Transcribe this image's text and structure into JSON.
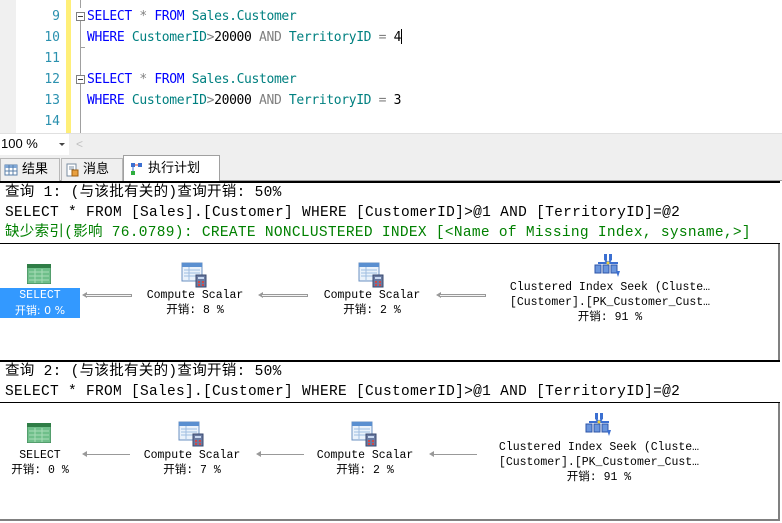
{
  "editor": {
    "lines": [
      {
        "num": "9",
        "tokens": [
          {
            "t": "SELECT",
            "c": "kw"
          },
          {
            "t": " * ",
            "c": "op"
          },
          {
            "t": "FROM",
            "c": "kw"
          },
          {
            "t": " Sales.Customer",
            "c": "id"
          }
        ]
      },
      {
        "num": "10",
        "tokens": [
          {
            "t": "WHERE",
            "c": "kw"
          },
          {
            "t": " CustomerID",
            "c": "id"
          },
          {
            "t": ">",
            "c": "op"
          },
          {
            "t": "20000",
            "c": "num"
          },
          {
            "t": " AND",
            "c": "op"
          },
          {
            "t": " TerritoryID",
            "c": "id"
          },
          {
            "t": " = ",
            "c": "op"
          },
          {
            "t": "4",
            "c": "num"
          }
        ]
      },
      {
        "num": "11",
        "tokens": []
      },
      {
        "num": "12",
        "tokens": [
          {
            "t": "SELECT",
            "c": "kw"
          },
          {
            "t": " * ",
            "c": "op"
          },
          {
            "t": "FROM",
            "c": "kw"
          },
          {
            "t": " Sales.Customer",
            "c": "id"
          }
        ]
      },
      {
        "num": "13",
        "tokens": [
          {
            "t": "WHERE",
            "c": "kw"
          },
          {
            "t": " CustomerID",
            "c": "id"
          },
          {
            "t": ">",
            "c": "op"
          },
          {
            "t": "20000",
            "c": "num"
          },
          {
            "t": " AND",
            "c": "op"
          },
          {
            "t": " TerritoryID",
            "c": "id"
          },
          {
            "t": " = ",
            "c": "op"
          },
          {
            "t": "3",
            "c": "num"
          }
        ]
      },
      {
        "num": "14",
        "tokens": []
      }
    ]
  },
  "zoom": {
    "value": "100 %"
  },
  "tabs": [
    {
      "label": "结果",
      "icon": "grid-icon",
      "active": false
    },
    {
      "label": "消息",
      "icon": "message-icon",
      "active": false
    },
    {
      "label": "执行计划",
      "icon": "execution-plan-icon",
      "active": true
    }
  ],
  "queries": [
    {
      "header": "查询 1: (与该批有关的)查询开销: 50%",
      "sql": "SELECT * FROM [Sales].[Customer] WHERE [CustomerID]>@1 AND [TerritoryID]=@2",
      "missing_index": "缺少索引(影响 76.0789): CREATE NONCLUSTERED INDEX [<Name of Missing Index, sysname,>]",
      "nodes": [
        {
          "name": "SELECT",
          "cost": "开销: 0 %",
          "selected": true
        },
        {
          "name": "Compute Scalar",
          "cost": "开销: 8 %"
        },
        {
          "name": "Compute Scalar",
          "cost": "开销: 2 %"
        },
        {
          "name": "Clustered Index Seek (Cluste…",
          "sub": "[Customer].[PK_Customer_Cust…",
          "cost": "开销: 91 %"
        }
      ]
    },
    {
      "header": "查询 2: (与该批有关的)查询开销: 50%",
      "sql": "SELECT * FROM [Sales].[Customer] WHERE [CustomerID]>@1 AND [TerritoryID]=@2",
      "nodes": [
        {
          "name": "SELECT",
          "cost": "开销: 0 %"
        },
        {
          "name": "Compute Scalar",
          "cost": "开销: 7 %"
        },
        {
          "name": "Compute Scalar",
          "cost": "开销: 2 %"
        },
        {
          "name": "Clustered Index Seek (Cluste…",
          "sub": "[Customer].[PK_Customer_Cust…",
          "cost": "开销: 91 %"
        }
      ]
    }
  ],
  "colors": {
    "selection": "#3399ff",
    "keyword": "#0000ff",
    "identifier": "#008080",
    "missing_index": "#008000",
    "line_number": "#2b91af"
  }
}
